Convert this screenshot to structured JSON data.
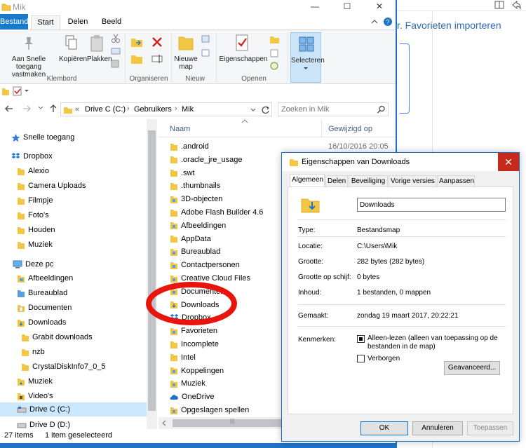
{
  "browser": {
    "import_link": "r. Favorieten importeren"
  },
  "window": {
    "title": "Mik",
    "minimize": "—",
    "maximize": "☐",
    "close": "✕"
  },
  "menu": {
    "tabs": [
      "Bestand",
      "Start",
      "Delen",
      "Beeld"
    ]
  },
  "ribbon": {
    "pin_label": "Aan Snelle toegang vastmaken",
    "copy_label": "Kopiëren",
    "paste_label": "Plakken",
    "new_folder_label": "Nieuwe map",
    "properties_label": "Eigenschappen",
    "select_label": "Selecteren",
    "groups": {
      "klembord": "Klembord",
      "organiseren": "Organiseren",
      "nieuw": "Nieuw",
      "openen": "Openen"
    }
  },
  "address": {
    "prefix": "«",
    "breadcrumb": [
      "Drive C (C:)",
      "Gebruikers",
      "Mik"
    ],
    "search_placeholder": "Zoeken in Mik"
  },
  "nav": {
    "quick_access": "Snelle toegang",
    "dropbox": "Dropbox",
    "dropbox_items": [
      "Alexio",
      "Camera Uploads",
      "Filmpje",
      "Foto's",
      "Houden",
      "Muziek"
    ],
    "this_pc": "Deze pc",
    "pc_items": [
      "Afbeeldingen",
      "Bureaublad",
      "Documenten",
      "Downloads"
    ],
    "download_items": [
      "Grabit downloads",
      "nzb",
      "CrystalDiskInfo7_0_5"
    ],
    "pc_items_after": [
      "Muziek",
      "Video's"
    ],
    "drives": [
      "Drive C (C:)",
      "Drive D (D:)"
    ]
  },
  "files": {
    "col_name": "Naam",
    "col_date": "Gewijzigd op",
    "first_date": "16/10/2016 20:05",
    "items": [
      ".android",
      ".oracle_jre_usage",
      ".swt",
      ".thumbnails",
      "3D-objecten",
      "Adobe Flash Builder 4.6",
      "Afbeeldingen",
      "AppData",
      "Bureaublad",
      "Contactpersonen",
      "Creative Cloud Files",
      "Documenten",
      "Downloads",
      "Dropbox",
      "Favorieten",
      "Incomplete",
      "Intel",
      "Koppelingen",
      "Muziek",
      "OneDrive",
      "Opgeslagen spellen"
    ]
  },
  "status": {
    "items": "27 items",
    "selected": "1 item geselecteerd"
  },
  "dialog": {
    "title": "Eigenschappen van Downloads",
    "tabs": [
      "Algemeen",
      "Delen",
      "Beveiliging",
      "Vorige versies",
      "Aanpassen"
    ],
    "name_value": "Downloads",
    "labels": {
      "type": "Type:",
      "location": "Locatie:",
      "size": "Grootte:",
      "size_on_disk": "Grootte op schijf:",
      "contents": "Inhoud:",
      "created": "Gemaakt:",
      "attributes": "Kenmerken:"
    },
    "values": {
      "type": "Bestandsmap",
      "location": "C:\\Users\\Mik",
      "size": "282 bytes (282 bytes)",
      "size_on_disk": "0 bytes",
      "contents": "1 bestanden, 0 mappen",
      "created": "zondag 19 maart 2017, 20:22:21"
    },
    "readonly_line1": "Alleen-lezen (alleen van toepassing op de",
    "readonly_line2": "bestanden in de map)",
    "hidden_label": "Verborgen",
    "advanced_button": "Geavanceerd...",
    "ok": "OK",
    "cancel": "Annuleren",
    "apply": "Toepassen"
  }
}
